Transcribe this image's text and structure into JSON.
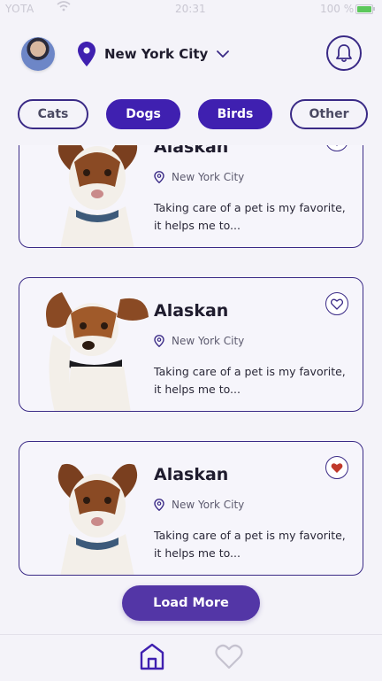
{
  "status_bar": {
    "carrier": "YOTA",
    "time": "20:31",
    "battery": "100 %"
  },
  "header": {
    "location": "New York City",
    "icons": {
      "avatar": "user-avatar",
      "pin": "location-pin-icon",
      "dropdown": "chevron-down-icon",
      "notifications": "bell-icon"
    }
  },
  "categories": [
    {
      "label": "Cats",
      "selected": false
    },
    {
      "label": "Dogs",
      "selected": true
    },
    {
      "label": "Birds",
      "selected": true
    },
    {
      "label": "Other",
      "selected": false
    }
  ],
  "pets": [
    {
      "name": "Alaskan",
      "location": "New York City",
      "description": "Taking care of a pet is my favorite, it helps me to...",
      "favorite": false
    },
    {
      "name": "Alaskan",
      "location": "New York City",
      "description": "Taking care of a pet is my favorite, it helps me to...",
      "favorite": false
    },
    {
      "name": "Alaskan",
      "location": "New York City",
      "description": "Taking care of a pet is my favorite, it helps me to...",
      "favorite": true
    }
  ],
  "actions": {
    "load_more": "Load More"
  },
  "tabs": [
    {
      "icon": "home-icon",
      "active": true
    },
    {
      "icon": "heart-icon",
      "active": false
    }
  ],
  "colors": {
    "accent": "#3f20b0",
    "outline": "#3a2a86",
    "button": "#5336a6",
    "favorite": "#c0392b",
    "background": "#f4f3f9"
  }
}
